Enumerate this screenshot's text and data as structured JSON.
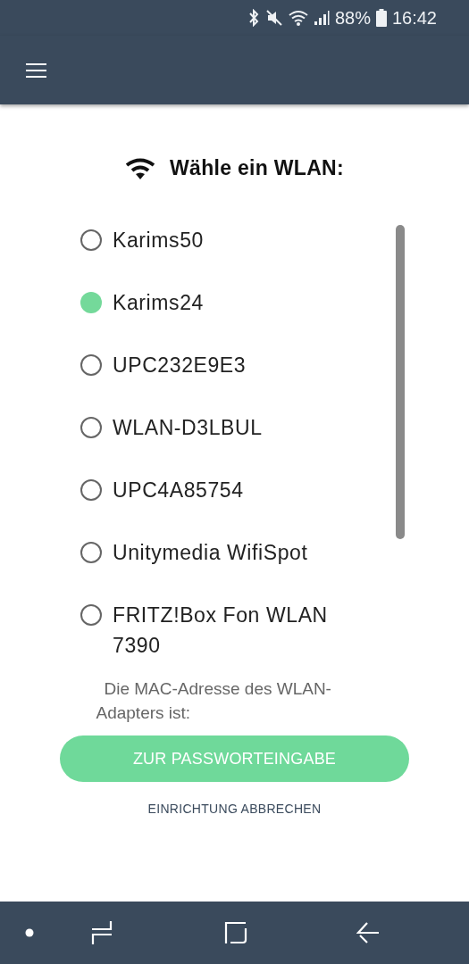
{
  "status_bar": {
    "battery": "88%",
    "time": "16:42"
  },
  "title": "Wähle ein WLAN:",
  "networks": [
    {
      "name": "Karims50",
      "selected": false
    },
    {
      "name": "Karims24",
      "selected": true
    },
    {
      "name": "UPC232E9E3",
      "selected": false
    },
    {
      "name": "WLAN-D3LBUL",
      "selected": false
    },
    {
      "name": "UPC4A85754",
      "selected": false
    },
    {
      "name": "Unitymedia WifiSpot",
      "selected": false
    },
    {
      "name": "FRITZ!Box Fon WLAN 7390",
      "selected": false
    }
  ],
  "mac_label": "Die MAC-Adresse des WLAN-Adapters ist:",
  "primary_button": "ZUR PASSWORTEINGABE",
  "cancel_link": "EINRICHTUNG ABBRECHEN"
}
